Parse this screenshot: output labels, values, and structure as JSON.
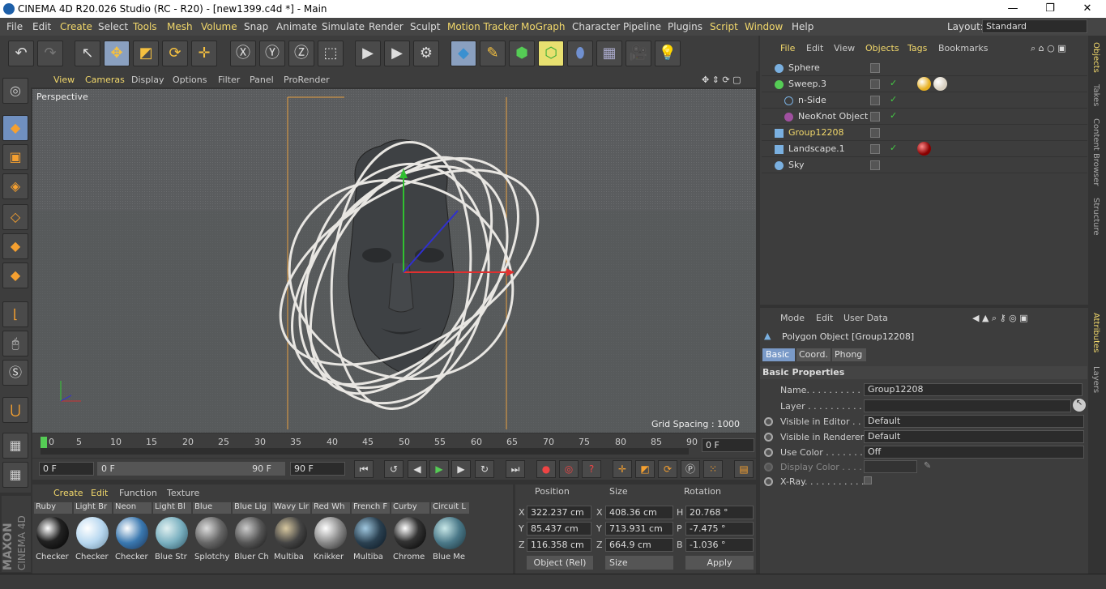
{
  "window": {
    "title": "CINEMA 4D R20.026 Studio (RC - R20) - [new1399.c4d *] - Main",
    "minimize": "—",
    "maximize": "❐",
    "close": "✕"
  },
  "menubar": {
    "items": [
      "File",
      "Edit",
      "Create",
      "Select",
      "Tools",
      "Mesh",
      "Volume",
      "Snap",
      "Animate",
      "Simulate",
      "Render",
      "Sculpt",
      "Motion Tracker",
      "MoGraph",
      "Character",
      "Pipeline",
      "Plugins",
      "Script",
      "Window",
      "Help"
    ],
    "layout_label": "Layout:",
    "layout_value": "Standard"
  },
  "viewport": {
    "menu": [
      "View",
      "Cameras",
      "Display",
      "Options",
      "Filter",
      "Panel",
      "ProRender"
    ],
    "label": "Perspective",
    "grid_spacing": "Grid Spacing : 1000 cm"
  },
  "timeline": {
    "ticks": [
      "0",
      "5",
      "10",
      "15",
      "20",
      "25",
      "30",
      "35",
      "40",
      "45",
      "50",
      "55",
      "60",
      "65",
      "70",
      "75",
      "80",
      "85",
      "90"
    ],
    "current_frame": "0 F"
  },
  "transport": {
    "start": "0 F",
    "range_start": "0 F",
    "range_end": "90 F",
    "end": "90 F"
  },
  "materials": {
    "menu": [
      "Create",
      "Edit",
      "Function",
      "Texture"
    ],
    "items": [
      {
        "name": "Ruby",
        "label": "Checker",
        "color": "#222"
      },
      {
        "name": "Light Br",
        "label": "Checker",
        "color": "#b8d8f0"
      },
      {
        "name": "Neon",
        "label": "Checker",
        "color": "#3a78b0"
      },
      {
        "name": "Light Bl",
        "label": "Blue Str",
        "color": "#7ab0c0"
      },
      {
        "name": "Blue",
        "label": "Splotchy",
        "color": "#666"
      },
      {
        "name": "Blue Lig",
        "label": "Bluer Ch",
        "color": "#555"
      },
      {
        "name": "Wavy Lir",
        "label": "Multiba",
        "color": "#444"
      },
      {
        "name": "Red Wh",
        "label": "Knikker",
        "color": "#888"
      },
      {
        "name": "French F",
        "label": "Multiba",
        "color": "#2a4050"
      },
      {
        "name": "Curby",
        "label": "Chrome",
        "color": "#333"
      },
      {
        "name": "Circuit L",
        "label": "Blue Me",
        "color": "#4a7888"
      }
    ]
  },
  "coords": {
    "headers": [
      "Position",
      "Size",
      "Rotation"
    ],
    "position": {
      "x": "322.237 cm",
      "y": "85.437 cm",
      "z": "116.358 cm"
    },
    "size": {
      "x": "408.36 cm",
      "y": "713.931 cm",
      "z": "664.9 cm"
    },
    "rotation": {
      "h": "20.768 °",
      "p": "-7.475 °",
      "b": "-1.036 °"
    },
    "mode": "Object (Rel)",
    "size_mode": "Size",
    "apply": "Apply"
  },
  "objects": {
    "menu": [
      "File",
      "Edit",
      "View",
      "Objects",
      "Tags",
      "Bookmarks"
    ],
    "items": [
      {
        "name": "Sphere"
      },
      {
        "name": "Sweep.3"
      },
      {
        "name": "n-Side"
      },
      {
        "name": "NeoKnot Object"
      },
      {
        "name": "Group12208"
      },
      {
        "name": "Landscape.1"
      },
      {
        "name": "Sky"
      }
    ]
  },
  "right_tabs": [
    "Objects",
    "Takes",
    "Content Browser",
    "Structure",
    "Attributes",
    "Layers"
  ],
  "attributes": {
    "menu": [
      "Mode",
      "Edit",
      "User Data"
    ],
    "title": "Polygon Object [Group12208]",
    "tabs": [
      "Basic",
      "Coord.",
      "Phong"
    ],
    "section": "Basic Properties",
    "rows": [
      {
        "label": "Name. . . . . . . . . . . . .",
        "value": "Group12208"
      },
      {
        "label": "Layer . . . . . . . . . . . .",
        "value": ""
      },
      {
        "label": "Visible in Editor . . .",
        "value": "Default"
      },
      {
        "label": "Visible in Renderer",
        "value": "Default"
      },
      {
        "label": "Use Color . . . . . . . .",
        "value": "Off"
      },
      {
        "label": "Display Color . . . .",
        "value": ""
      },
      {
        "label": "X-Ray. . . . . . . . . . . .",
        "value": ""
      }
    ]
  },
  "brand": {
    "line1": "MAXON",
    "line2": "CINEMA 4D"
  }
}
